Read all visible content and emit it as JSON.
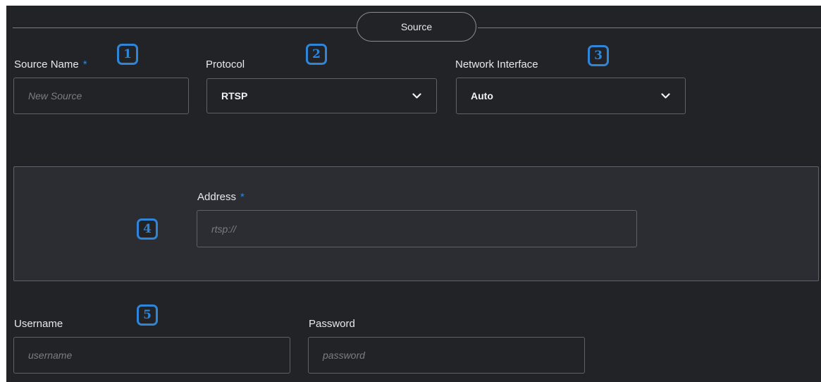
{
  "section": {
    "title": "Source"
  },
  "fields": {
    "source_name": {
      "label": "Source Name",
      "required_mark": "*",
      "placeholder": "New Source",
      "badge": "1"
    },
    "protocol": {
      "label": "Protocol",
      "value": "RTSP",
      "badge": "2",
      "icon": "chevron-down-icon"
    },
    "network_interface": {
      "label": "Network Interface",
      "value": "Auto",
      "badge": "3",
      "icon": "chevron-down-icon"
    },
    "address": {
      "label": "Address",
      "required_mark": "*",
      "placeholder": "rtsp://",
      "badge": "4"
    },
    "username": {
      "label": "Username",
      "placeholder": "username",
      "badge": "5"
    },
    "password": {
      "label": "Password",
      "placeholder": "password"
    }
  },
  "colors": {
    "background": "#222327",
    "panel": "#2c2d33",
    "accent": "#2f86d9",
    "border": "#5f6269",
    "text": "#e8e9ec",
    "placeholder": "#7a7d83"
  }
}
